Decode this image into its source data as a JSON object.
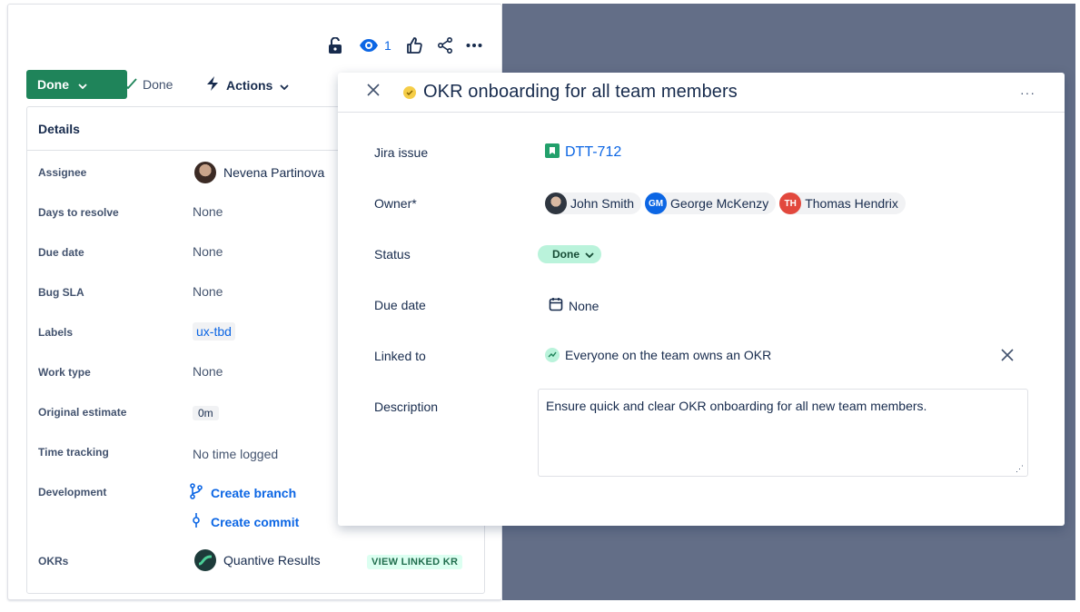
{
  "jira_panel": {
    "watch_count": "1",
    "status_button": "Done",
    "done_indicator": "Done",
    "actions_button": "Actions",
    "details_title": "Details",
    "fields": [
      {
        "label": "Assignee",
        "value": "Nevena Partinova"
      },
      {
        "label": "Days to resolve",
        "value": "None"
      },
      {
        "label": "Due date",
        "value": "None"
      },
      {
        "label": "Bug SLA",
        "value": "None"
      },
      {
        "label": "Labels",
        "value": "ux-tbd"
      },
      {
        "label": "Work type",
        "value": "None"
      },
      {
        "label": "Original estimate",
        "value": "0m"
      },
      {
        "label": "Time tracking",
        "value": "No time logged"
      },
      {
        "label": "Development",
        "value": "Create branch",
        "value2": "Create commit"
      },
      {
        "label": "OKRs",
        "value": "Quantive Results",
        "action": "VIEW LINKED KR"
      }
    ]
  },
  "modal": {
    "title": "OKR onboarding for all team members",
    "more_label": "···",
    "jira_issue_label": "Jira issue",
    "jira_issue_key": "DTT-712",
    "owner_label": "Owner*",
    "owners": [
      {
        "name": "John Smith",
        "initials": "",
        "color": "#44546f"
      },
      {
        "name": "George McKenzy",
        "initials": "GM",
        "color": "#0c66e4"
      },
      {
        "name": "Thomas Hendrix",
        "initials": "TH",
        "color": "#e2483d"
      }
    ],
    "status_label": "Status",
    "status_value": "Done",
    "due_date_label": "Due date",
    "due_date_value": "None",
    "linked_to_label": "Linked to",
    "linked_to_value": "Everyone on the team owns an OKR",
    "description_label": "Description",
    "description_value": "Ensure quick and clear OKR onboarding for all new team members."
  },
  "colors": {
    "backdrop": "#636e87",
    "status_green": "#1f845a",
    "link_blue": "#0c66e4"
  }
}
